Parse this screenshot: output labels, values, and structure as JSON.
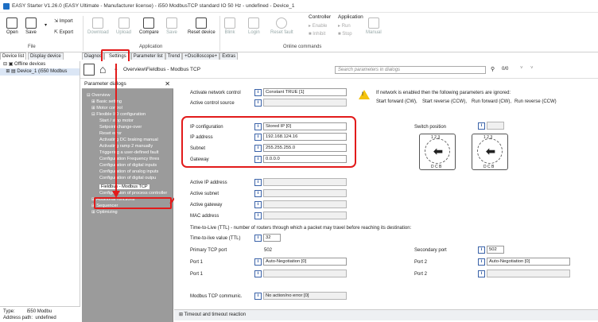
{
  "window": {
    "title": "EASY Starter V1.26.0 (EASY Ultimate - Manufacturer license) - i550 ModbusTCP standard IO 50 Hz - undefined - Device_1"
  },
  "ribbon": {
    "file": {
      "open": "Open",
      "save": "Save",
      "import": "Import",
      "export": "Export",
      "group": "File"
    },
    "application": {
      "download": "Download",
      "upload": "Upload",
      "compare": "Compare",
      "save": "Save",
      "reset_device": "Reset device",
      "group": "Application"
    },
    "online": {
      "blink": "Blink",
      "login": "Login",
      "reset_fault": "Reset fault",
      "group": "Online commands",
      "controller_title": "Controller",
      "enable": "Enable",
      "inhibit": "Inhibit",
      "application_title": "Application",
      "run": "Run",
      "stop": "Stop",
      "manual": "Manual"
    }
  },
  "left_tabs": {
    "device_list": "Device list",
    "display_device": "Display device"
  },
  "tree": {
    "offline": "Offline devices",
    "device": "Device_1 (i550 Modbus"
  },
  "status": {
    "type_label": "Type:",
    "type_value": "i550 Modbu",
    "addr_label": "Address path:",
    "addr_value": "undefined"
  },
  "tabs": [
    "Diagnos",
    "Settings",
    "Parameter list",
    "Trend",
    "+Oscilloscope+",
    "Extras"
  ],
  "breadcrumb": "Overview\\Fieldbus - Modbus TCP",
  "search": {
    "placeholder": "Search parameters in dialogs",
    "count": "0/0"
  },
  "param_dialog": {
    "title": "Parameter dialogs",
    "items": [
      "Overview",
      "Basic setting",
      "Motor control",
      "Flexible I/O configuration",
      "Start / stop motor",
      "Setpoint change-over",
      "Reset error",
      "Activating DC braking manual",
      "Activating ramp 2 manually",
      "Triggering a user-defined fault",
      "Configuration Frequency thres",
      "Configuration of digital inputs",
      "Configuration of analog inputs",
      "Configuration of digital outpu",
      "Fieldbus - Modbus TCP",
      "Configuration of process controller",
      "Additional functions",
      "Sequencer",
      "Optimizing"
    ]
  },
  "form": {
    "activate_network_control": {
      "label": "Activate network control",
      "value": "Constant TRUE [1]"
    },
    "active_control_source": {
      "label": "Active control source",
      "value": ""
    },
    "warning": {
      "line1": "If network is enabled then the following parameters are ignored:",
      "items": [
        "Start forward (CW),",
        "Start reverse (CCW),",
        "Run forward (CW),",
        "Run reverse (CCW)"
      ]
    },
    "ip_config": {
      "label": "IP configuration",
      "value": "Stored IP [0]"
    },
    "ip_address": {
      "label": "IP address",
      "value": "192.168.124.16"
    },
    "subnet": {
      "label": "Subnet",
      "value": "255.255.255.0"
    },
    "gateway": {
      "label": "Gateway",
      "value": "0.0.0.0"
    },
    "switch_position": {
      "label": "Switch position",
      "dial1_top": "1 2 3",
      "dial2_top": "1 2 3",
      "dial_bottom": "D C B"
    },
    "active_ip": {
      "label": "Active IP address",
      "value": ""
    },
    "active_subnet": {
      "label": "Active subnet",
      "value": ""
    },
    "active_gateway": {
      "label": "Active gateway",
      "value": ""
    },
    "mac": {
      "label": "MAC address",
      "value": ""
    },
    "ttl_note": "Time-to-Live (TTL) - number of routers through which a packet may travel before reaching its destination:",
    "ttl": {
      "label": "Time-to-live value (TTL)",
      "value": "32"
    },
    "primary_port": {
      "label": "Primary TCP port",
      "value": "502"
    },
    "secondary_port": {
      "label": "Secondary port",
      "value": "502"
    },
    "port1": {
      "label": "Port 1",
      "value": "Auto-Negotiation [0]"
    },
    "port2": {
      "label": "Port 2",
      "value": "Auto-Negotiation [0]"
    },
    "port1b": {
      "label": "Port 1",
      "value": ""
    },
    "port2b": {
      "label": "Port 2",
      "value": ""
    },
    "modbus_comm": {
      "label": "Modbus TCP communic.",
      "value": "No action/no error [0]"
    }
  },
  "bottom_section": "Timeout and timeout reaction",
  "colors": {
    "highlight": "#e21b1b",
    "info": "#3a62a8",
    "panel": "#9b9b9b"
  }
}
